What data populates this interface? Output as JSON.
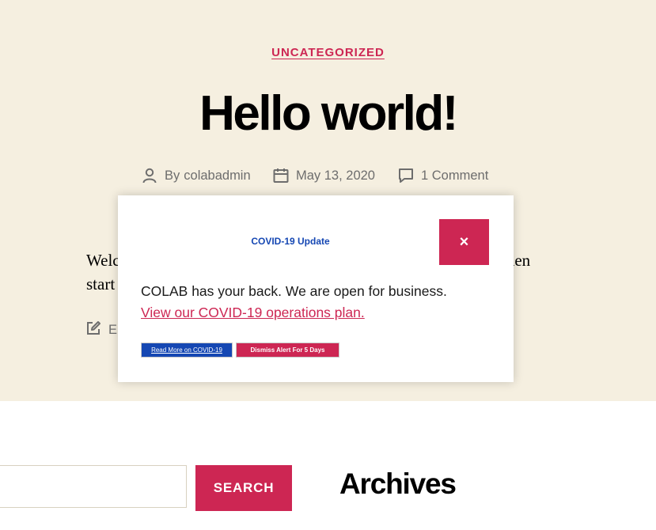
{
  "post": {
    "category": "UNCATEGORIZED",
    "title": "Hello world!",
    "meta": {
      "author_prefix": "By",
      "author": "colabadmin",
      "date": "May 13, 2020",
      "comments": "1 Comment"
    },
    "body_line1_start": "Welc",
    "body_line1_end": "then",
    "body_line2_start": "start",
    "edit_fragment": "E"
  },
  "widgets": {
    "search": {
      "button_label": "SEARCH",
      "placeholder": ""
    },
    "archives_title": "Archives"
  },
  "alert": {
    "heading": "COVID-19 Update",
    "close_label": "×",
    "message": "COLAB has your back. We are open for business.",
    "link_text": "View our COVID-19 operations plan.",
    "read_more_label": "Read More on COVID-19",
    "dismiss_label": "Dismiss Alert For 5 Days"
  },
  "colors": {
    "accent": "#cd2653",
    "alert_blue": "#1547b3",
    "background": "#f5efe0",
    "meta_gray": "#6d6d6d"
  },
  "icons": {
    "author": "person-icon",
    "date": "calendar-icon",
    "comments": "comment-icon",
    "edit": "edit-icon",
    "close": "close-icon"
  }
}
